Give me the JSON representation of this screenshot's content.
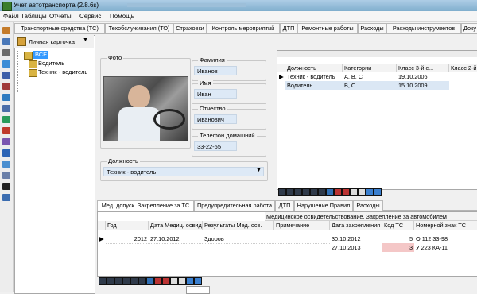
{
  "window": {
    "title": "Учет автотранспорта (2.8.6s)"
  },
  "menu": [
    "Файл",
    "Таблицы",
    "Отчеты",
    "Сервис",
    "Помощь"
  ],
  "tabs": [
    "Транспортные средства (ТС)",
    "Техобслуживания (ТО)",
    "Страховки",
    "Контроль мероприятий",
    "ДТП",
    "Ремонтные работы",
    "Расходы",
    "Расходы инструментов",
    "Доку"
  ],
  "tree": {
    "toolbar_label": "Личная карточка",
    "root": "ВСЕ",
    "items": [
      "Водитель",
      "Техник - водитель"
    ]
  },
  "card": {
    "photo_label": "Фото",
    "surname_label": "Фамилия",
    "surname": "Иванов",
    "name_label": "Имя",
    "name": "Иван",
    "patronymic_label": "Отчество",
    "patronymic": "Иванович",
    "phone_label": "Телефон домашний",
    "phone": "33-22-55",
    "position_label": "Должность",
    "position": "Техник - водитель"
  },
  "positions_grid": {
    "headers": [
      "Должность",
      "Категории",
      "Класс 3-й с...",
      "Класс 2-й"
    ],
    "rows": [
      {
        "pos": "Техник - водитель",
        "cat": "A, B, C",
        "cls": "19.10.2006"
      },
      {
        "pos": "Водитель",
        "cat": "B, C",
        "cls": "15.10.2009"
      }
    ]
  },
  "bottom_tabs": [
    "Мед. допуск. Закрепление за ТС",
    "Предупредительная работа",
    "ДТП",
    "Нарушение Правил",
    "Расходы"
  ],
  "med_grid": {
    "group_header": "Медицинское освидетельствование. Закрепление за автомобилем",
    "headers": [
      "Год",
      "Дата Медиц. освид.",
      "Результаты Мед. осв.",
      "Примечание",
      "Дата закрепления",
      "Код ТС",
      "Номерной знак ТС"
    ],
    "rows": [
      {
        "year": "2012",
        "date": "27.10.2012",
        "result": "Здоров",
        "note": "",
        "fix_date": "30.10.2012",
        "code": "5",
        "plate": "О 112 33-98"
      },
      {
        "year": "",
        "date": "",
        "result": "",
        "note": "",
        "fix_date": "27.10.2013",
        "code": "3",
        "plate": "У 223 КА-11"
      }
    ]
  },
  "colors": {
    "titlebar": "#8fb6d6",
    "field_bg": "#dde9f6",
    "selected": "#dbe7f4",
    "highlight_red": "#f4c7c7"
  }
}
